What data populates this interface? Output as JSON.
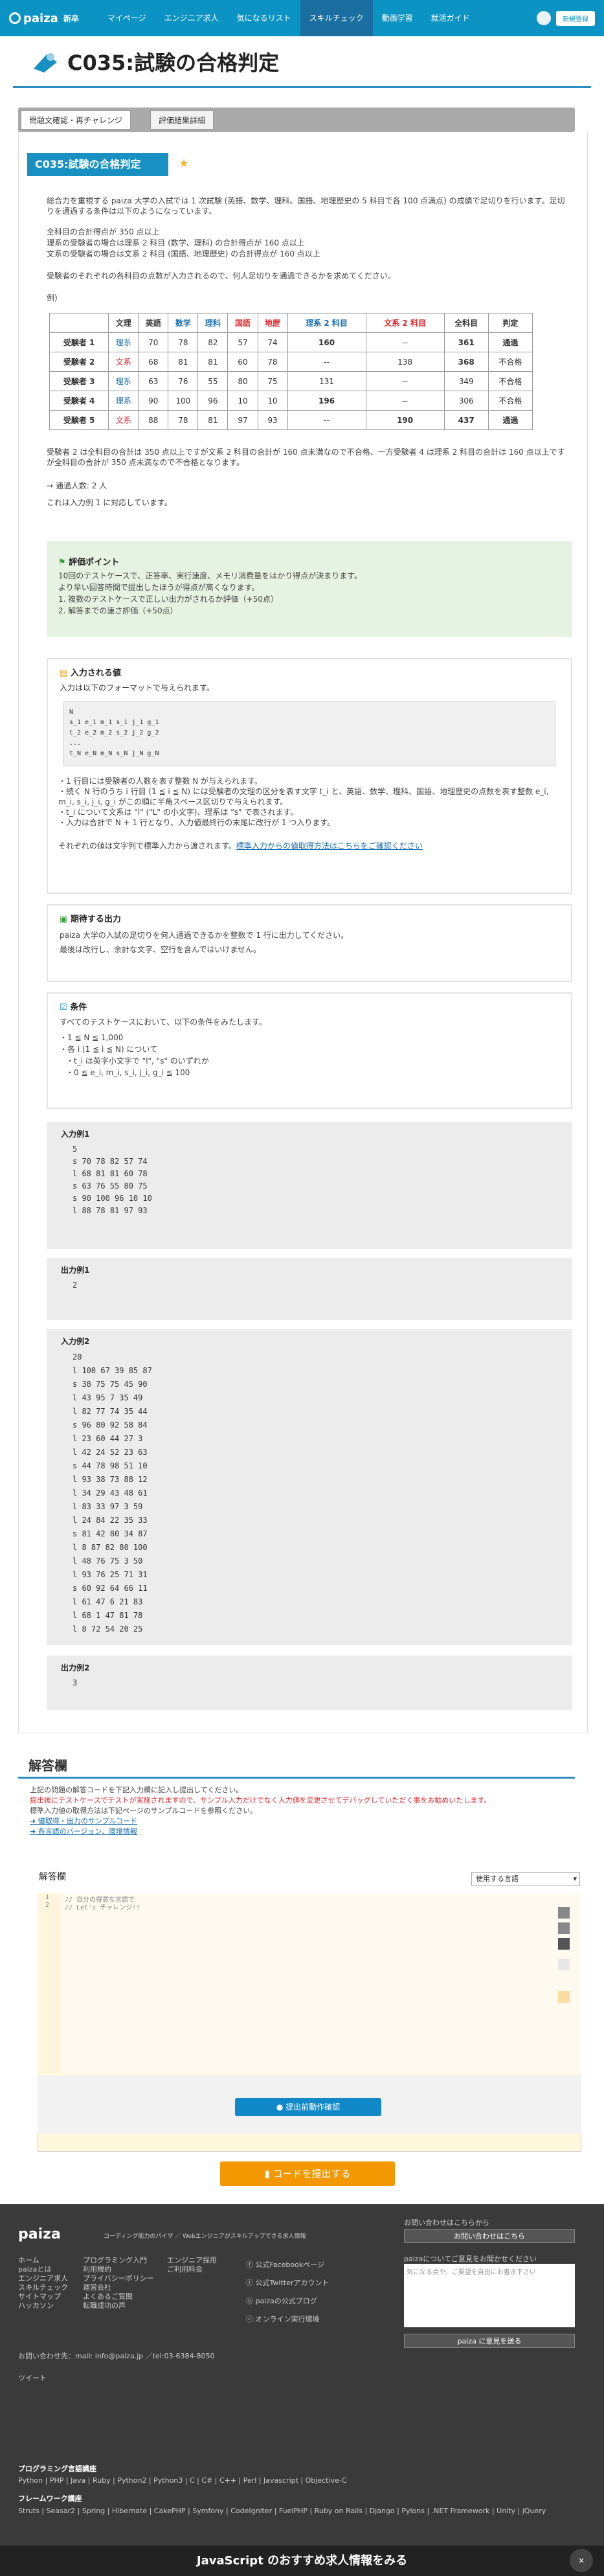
{
  "nav": {
    "logo": "paiza",
    "logo_sub": "新卒",
    "items": [
      "マイページ",
      "エンジニア求人",
      "気になるリスト",
      "スキルチェック",
      "動画学習",
      "就活ガイド"
    ],
    "register": "新規登録"
  },
  "title": "C035:試験の合格判定",
  "tabs": [
    "問題文確認・再チャレンジ",
    "評価結果詳細"
  ],
  "problem": {
    "heading": "C035:試験の合格判定",
    "p1": "総合力を重視する paiza 大学の入試では 1 次試験 (英語、数学、理科、国語、地理歴史の 5 科目で各 100 点満点) の成績で足切りを行います。足切りを通過する条件は以下のようになっています。",
    "p2": "全科目の合計得点が 350 点以上",
    "p3": "理系の受験者の場合は理系 2 科目 (数学、理科) の合計得点が 160 点以上",
    "p4": "文系の受験者の場合は文系 2 科目 (国語、地理歴史) の合計得点が 160 点以上",
    "p5": "受験者のそれぞれの各科目の点数が入力されるので、何人足切りを通過できるかを求めてください。",
    "p6": "例)",
    "headers": [
      "",
      "文理",
      "英語",
      "数学",
      "理科",
      "国語",
      "地歴",
      "理系 2 科目",
      "文系 2 科目",
      "全科目",
      "判定"
    ],
    "rows": [
      [
        "受験者 1",
        "理系",
        "70",
        "78",
        "82",
        "57",
        "74",
        "160",
        "--",
        "361",
        "通過"
      ],
      [
        "受験者 2",
        "文系",
        "68",
        "81",
        "81",
        "60",
        "78",
        "--",
        "138",
        "368",
        "不合格"
      ],
      [
        "受験者 3",
        "理系",
        "63",
        "76",
        "55",
        "80",
        "75",
        "131",
        "--",
        "349",
        "不合格"
      ],
      [
        "受験者 4",
        "理系",
        "90",
        "100",
        "96",
        "10",
        "10",
        "196",
        "--",
        "306",
        "不合格"
      ],
      [
        "受験者 5",
        "文系",
        "88",
        "78",
        "81",
        "97",
        "93",
        "--",
        "190",
        "437",
        "通過"
      ]
    ],
    "p7": "受験者 2 は全科目の合計は 350 点以上ですが文系 2 科目の合計が 160 点未満なので不合格、一方受験者 4 は理系 2 科目の合計は 160 点以上ですが全科目の合計が 350 点未満なので不合格となります。",
    "p8": "→ 通過人数: 2 人",
    "p9": "これは入力例 1 に対応しています。"
  },
  "hint": {
    "title": "評価ポイント",
    "l1": "10回のテストケースで、正答率、実行速度、メモリ消費量をはかり得点が決まります。",
    "l2": "より早い回答時間で提出したほうが得点が高くなります。",
    "l3": "1. 複数のテストケースで正しい出力がされるか評価（+50点）",
    "l4": "2. 解答までの速さ評価（+50点）"
  },
  "input": {
    "title": "入力される値",
    "desc": "入力は以下のフォーマットで与えられます。",
    "code": "N\ns_1 e_1 m_1 s_1 j_1 g_1\nt_2 e_2 m_2 s_2 j_2 g_2\n...\nt_N e_N m_N s_N j_N g_N",
    "n1": "・1 行目には受験者の人数を表す整数 N が与えられます。",
    "n2": "・続く N 行のうち i 行目 (1 ≦ i ≦ N) には受験者の文理の区分を表す文字 t_i と、英語、数学、理科、国語、地理歴史の点数を表す整数 e_i, m_i, s_i, j_i, g_i がこの順に半角スペース区切りで与えられます。",
    "n3": "・t_i について文系は \"l\" (\"L\" の小文字)、理系は \"s\" で表されます。",
    "n4": "・入力は合計で N + 1 行となり、入力値最終行の末尾に改行が 1 つ入ります。",
    "n5": "それぞれの値は文字列で標準入力から渡されます。",
    "link": "標準入力からの値取得方法はこちらをご確認ください"
  },
  "output": {
    "title": "期待する出力",
    "d1": "paiza 大学の入試の足切りを何人通過できるかを整数で 1 行に出力してください。",
    "d2": "最後は改行し、余計な文字、空行を含んではいけません。"
  },
  "cond": {
    "title": "条件",
    "d1": "すべてのテストケースにおいて、以下の条件をみたします。",
    "c1": "・1 ≦ N ≦ 1,000",
    "c2": "・各 i (1 ≦ i ≦ N) について",
    "c3": "・t_i は英字小文字で \"l\", \"s\" のいずれか",
    "c4": "・0 ≦ e_i, m_i, s_i, j_i, g_i ≦ 100"
  },
  "ex1": {
    "label": "入力例1",
    "body": "5\ns 70 78 82 57 74\nl 68 81 81 60 78\ns 63 76 55 80 75\ns 90 100 96 10 10\nl 88 78 81 97 93"
  },
  "out1": {
    "label": "出力例1",
    "body": "2"
  },
  "ex2": {
    "label": "入力例2",
    "body": "20\nl 100 67 39 85 87\ns 38 75 75 45 90\nl 43 95 7 35 49\nl 82 77 74 35 44\ns 96 80 92 58 84\nl 23 60 44 27 3\nl 42 24 52 23 63\ns 44 78 98 51 10\nl 93 38 73 88 12\nl 34 29 43 48 61\nl 83 33 97 3 59\nl 24 84 22 35 33\ns 81 42 80 34 87\nl 8 87 82 80 100\nl 48 76 75 3 50\nl 93 76 25 71 31\ns 60 92 64 66 11\nl 61 47 6 21 83\nl 68 1 47 81 78\nl 8 72 54 20 25"
  },
  "out2": {
    "label": "出力例2",
    "body": "3"
  },
  "answer": {
    "title": "解答欄",
    "a1": "上記の問題の解答コードを下記入力欄に記入し提出してください。",
    "a2": "提出後にテストケースでテストが実施されますので、サンプル入力だけでなく入力値を変更させてデバッグしていただく事をお勧めいたします。",
    "a3": "標準入力値の取得方法は下記ページのサンプルコードを参照ください。",
    "l1": "値取得・出力のサンプルコード",
    "l2": "各言語のバージョン、環境情報",
    "editor_label": "解答欄",
    "lang_select": "使用する言語",
    "line1": "// 自分の得意な言語で",
    "line2": "// Let's チャレンジ!!",
    "check_btn": "提出前動作確認",
    "submit_btn": "コードを提出する"
  },
  "footer": {
    "logo": "paiza",
    "tagline": "コーディング能力のパイザ ／ Webエンジニアがスキルアップできる求人情報",
    "col1": [
      "ホーム",
      "paizaとは",
      "エンジニア求人",
      "スキルチェック",
      "サイトマップ",
      "ハッカソン"
    ],
    "col2": [
      "プログラミング入門",
      "利用規約",
      "プライバシーポリシー",
      "運営会社",
      "よくあるご質問",
      "転職成功の声"
    ],
    "col3": [
      "エンジニア採用",
      "ご利用料金"
    ],
    "social": [
      "公式Facebookページ",
      "公式Twitterアカウント",
      "paizaの公式ブログ",
      "オンライン実行環境"
    ],
    "contact": "お問い合わせはこちらから",
    "contact_btn": "お問い合わせはこちら",
    "opinion": "paizaについてご意見をお聞かせください",
    "opinion_ph": "気になる点や、ご要望を自由にお書き下さい",
    "opinion_btn": "paiza に意見を送る",
    "mail": "お問い合わせ先：mail: info@paiza.jp ／tel:03-6384-8050",
    "tweet": "ツイート",
    "lang_title": "プログラミング言語講座",
    "langs": "Python | PHP | Java | Ruby | Python2 | Python3 | C | C# | C++ | Perl | Javascript | Objective-C",
    "fw_title": "フレームワーク講座",
    "fws": "Struts | Seasar2 | Spring | Hibernate | CakePHP | Symfony | CodeIgniter | FuelPHP | Ruby on Rails | Django | Pylons | .NET Framework | Unity | jQuery",
    "bar": "JavaScript のおすすめ求人情報をみる"
  }
}
